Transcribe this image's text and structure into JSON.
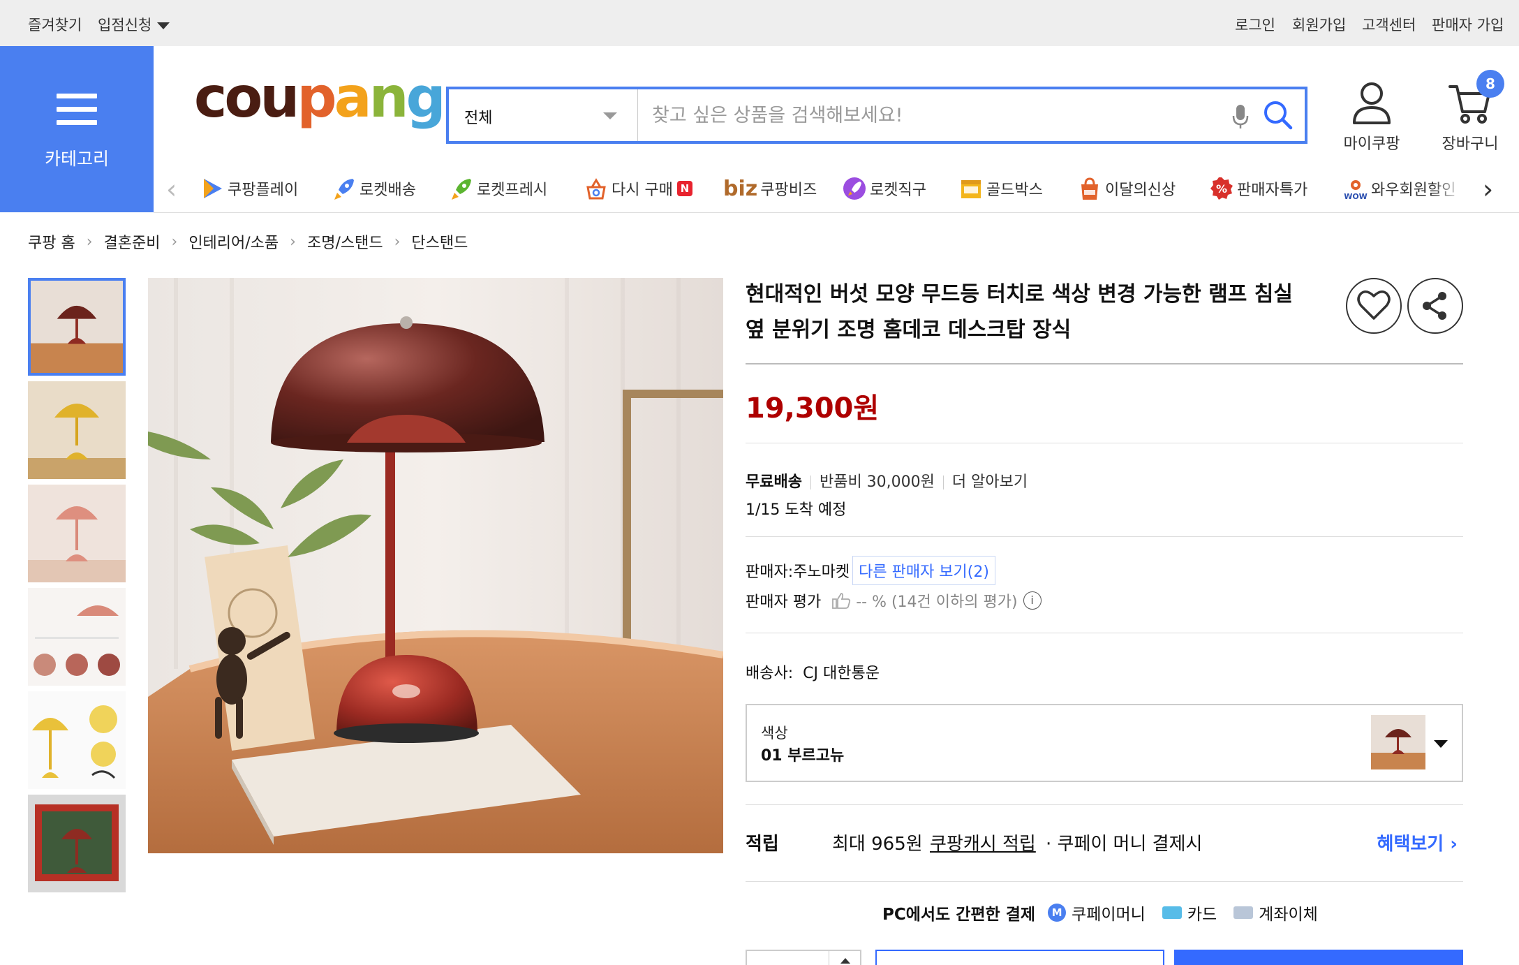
{
  "topbar": {
    "favorites": "즐겨찾기",
    "store_apply": "입점신청",
    "login": "로그인",
    "signup": "회원가입",
    "customer_center": "고객센터",
    "seller_signup": "판매자 가입"
  },
  "header": {
    "category_label": "카테고리",
    "logo_letters": [
      "c",
      "o",
      "u",
      "p",
      "a",
      "n",
      "g"
    ],
    "search": {
      "scope": "전체",
      "placeholder": "찾고 싶은 상품을 검색해보세요!"
    },
    "my_coupang": "마이쿠팡",
    "cart": "장바구니",
    "cart_count": "8"
  },
  "category_nav": {
    "items": [
      {
        "label": "쿠팡플레이",
        "icon": "play-icon"
      },
      {
        "label": "로켓배송",
        "icon": "rocket-icon"
      },
      {
        "label": "로켓프레시",
        "icon": "rocket-fresh-icon"
      },
      {
        "label": "다시 구매",
        "badge": "N",
        "icon": "rebuy-icon"
      },
      {
        "label": "쿠팡비즈",
        "prefix": "biz",
        "icon": "biz-icon"
      },
      {
        "label": "로켓직구",
        "icon": "rocket-global-icon"
      },
      {
        "label": "골드박스",
        "icon": "goldbox-icon"
      },
      {
        "label": "이달의신상",
        "icon": "new-bag-icon"
      },
      {
        "label": "판매자특가",
        "icon": "percent-icon"
      },
      {
        "label": "와우회원할인",
        "icon": "wow-icon"
      }
    ]
  },
  "breadcrumb": [
    "쿠팡 홈",
    "결혼준비",
    "인테리어/소품",
    "조명/스탠드",
    "단스탠드"
  ],
  "product": {
    "title": "현대적인 버섯 모양 무드등 터치로 색상 변경 가능한 램프 침실 옆 분위기 조명 홈데코 데스크탑 장식",
    "price": "19,300원",
    "shipping": {
      "free": "무료배송",
      "return_fee": "반품비 30,000원",
      "more": "더 알아보기",
      "arrival": "1/15 도착 예정"
    },
    "seller": {
      "label": "판매자:",
      "name": "주노마켓",
      "other_sellers": "다른 판매자 보기(2)",
      "rating_label": "판매자 평가",
      "rating_value": "-- % (14건 이하의 평가)",
      "info_symbol": "i"
    },
    "courier": {
      "label": "배송사:",
      "name": "CJ 대한통운"
    },
    "option": {
      "label": "색상",
      "value": "01 부르고뉴"
    },
    "reward": {
      "label": "적립",
      "max": "최대 965원",
      "link": "쿠팡캐시 적립",
      "condition": "· 쿠페이 머니 결제시",
      "more": "혜택보기 ›"
    },
    "payment": {
      "title": "PC에서도 간편한 결제",
      "m_badge": "M",
      "methods": [
        "쿠페이머니",
        "카드",
        "계좌이체"
      ]
    }
  },
  "colors": {
    "brand_blue": "#4a7ff0",
    "link_blue": "#346aff",
    "price_red": "#ae0000",
    "logo": [
      "#4a1d12",
      "#4a1d12",
      "#4a1d12",
      "#e2622b",
      "#f3a21b",
      "#8bb43a",
      "#48a6d9"
    ]
  }
}
